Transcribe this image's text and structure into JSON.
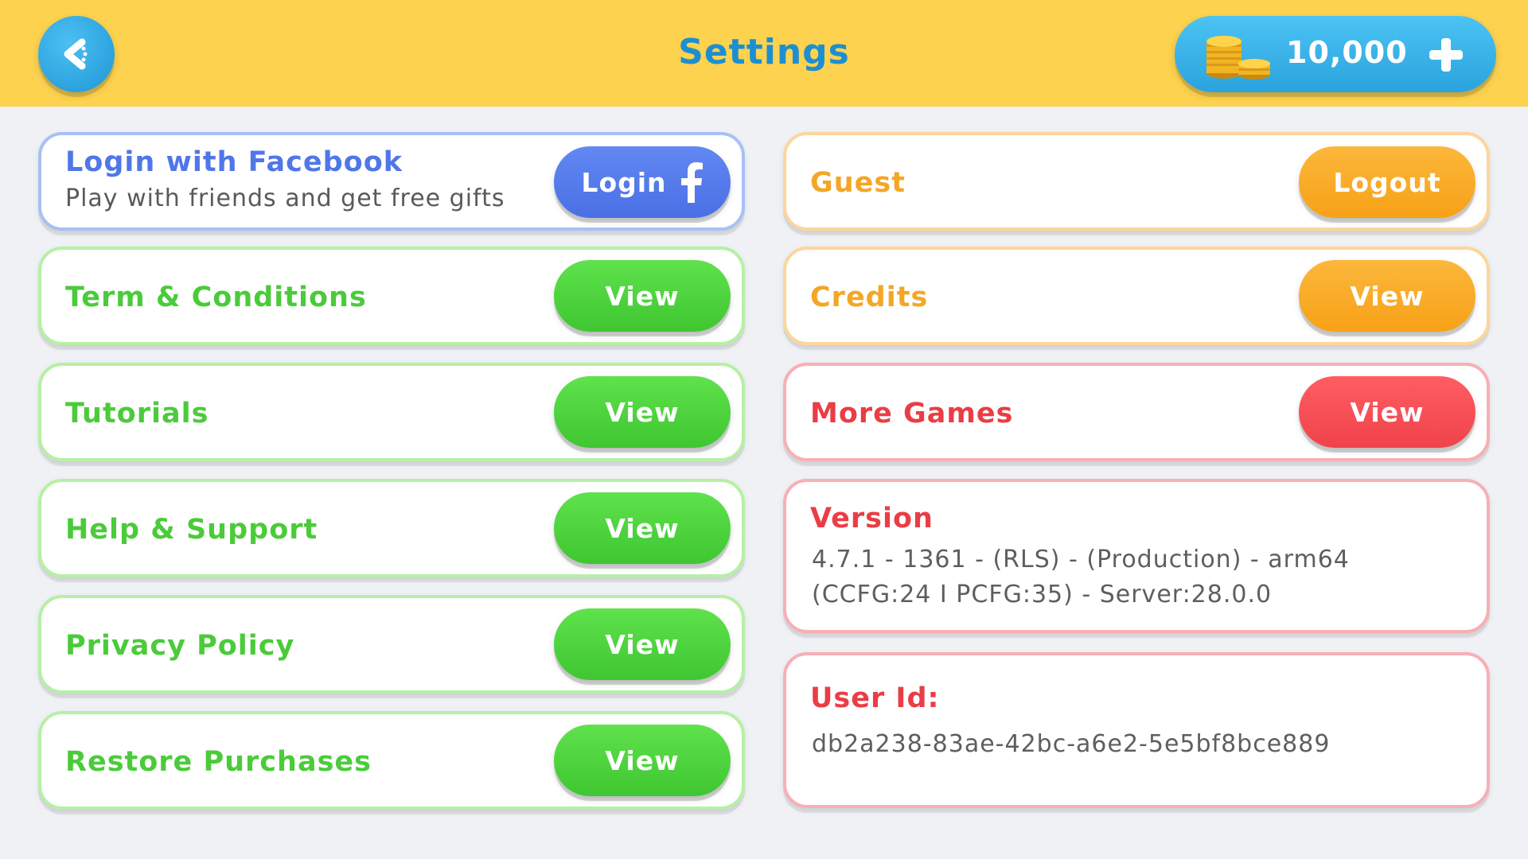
{
  "header": {
    "title": "Settings",
    "coins": "10,000",
    "icons": {
      "back": "back-arrow-icon",
      "coins": "coin-stack-icon",
      "add": "plus-icon"
    }
  },
  "left_cards": {
    "facebook": {
      "title": "Login with Facebook",
      "subtitle": "Play with friends and get free gifts",
      "button": "Login"
    },
    "terms": {
      "label": "Term & Conditions",
      "button": "View"
    },
    "tutorials": {
      "label": "Tutorials",
      "button": "View"
    },
    "help": {
      "label": "Help & Support",
      "button": "View"
    },
    "privacy": {
      "label": "Privacy Policy",
      "button": "View"
    },
    "restore": {
      "label": "Restore Purchases",
      "button": "View"
    }
  },
  "right_cards": {
    "account": {
      "label": "Guest",
      "button": "Logout"
    },
    "credits": {
      "label": "Credits",
      "button": "View"
    },
    "more_games": {
      "label": "More Games",
      "button": "View"
    },
    "version": {
      "label": "Version",
      "line1": "4.7.1 - 1361 - (RLS) - (Production) - arm64",
      "line2": "(CCFG:24 I PCFG:35) - Server:28.0.0"
    },
    "user_id": {
      "label": "User Id:",
      "value": "db2a238-83ae-42bc-a6e2-5e5bf8bce889"
    }
  },
  "colors": {
    "header_bg": "#fdd24f",
    "title": "#1d8fd0",
    "green": "#4bcb3a",
    "blue": "#5077e8",
    "orange": "#f4a624",
    "red": "#ea3d45"
  }
}
